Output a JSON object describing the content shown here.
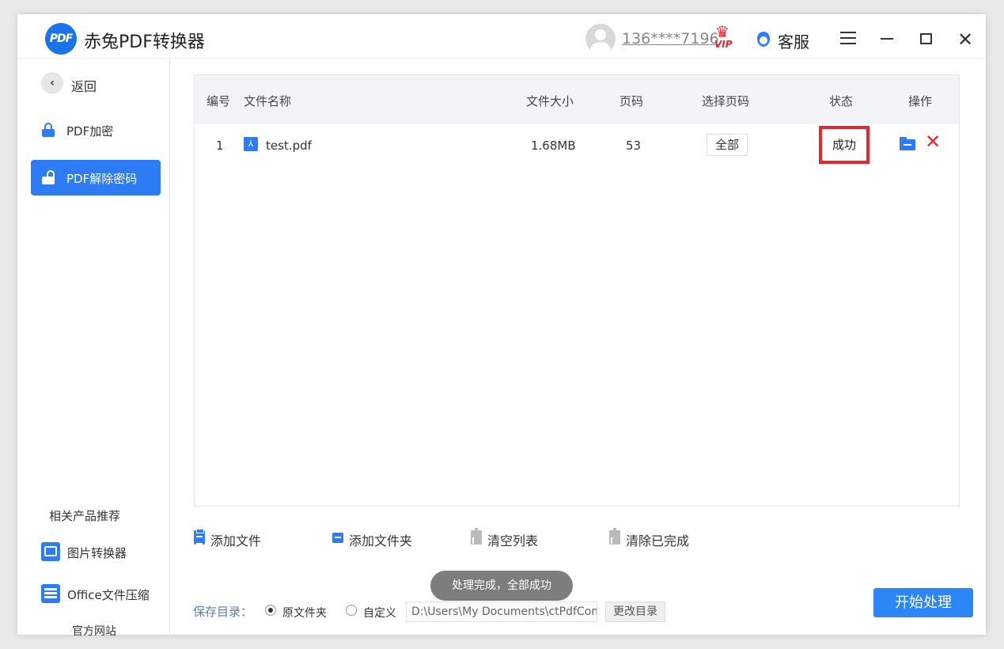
{
  "app": {
    "logo_text": "PDF",
    "title": "赤兔PDF转换器"
  },
  "header": {
    "user": "136****7196",
    "vip_badge": "VIP",
    "service_label": "客服"
  },
  "sidebar": {
    "back_label": "返回",
    "items": [
      {
        "label": "PDF加密",
        "active": false
      },
      {
        "label": "PDF解除密码",
        "active": true
      }
    ],
    "related_title": "相关产品推荐",
    "related": [
      {
        "label": "图片转换器"
      },
      {
        "label": "Office文件压缩"
      }
    ],
    "official_site": "官方网站"
  },
  "table": {
    "columns": [
      "编号",
      "文件名称",
      "文件大小",
      "页码",
      "选择页码",
      "状态",
      "操作"
    ],
    "rows": [
      {
        "index": "1",
        "name": "test.pdf",
        "size": "1.68MB",
        "pages": "53",
        "page_select": "全部",
        "status": "成功"
      }
    ]
  },
  "toolbar": {
    "add_file": "添加文件",
    "add_folder": "添加文件夹",
    "clear_list": "清空列表",
    "clear_done": "清除已完成"
  },
  "toast": "处理完成，全部成功",
  "save": {
    "label": "保存目录：",
    "option_original": "原文件夹",
    "option_custom": "自定义",
    "selected": "原文件夹",
    "path": "D:\\Users\\My Documents\\ctPdfCon",
    "change_button": "更改目录"
  },
  "start_button": "开始处理",
  "colors": {
    "accent": "#2d7cf6",
    "danger": "#e8262d",
    "toast_bg": "#7d7d7d"
  }
}
